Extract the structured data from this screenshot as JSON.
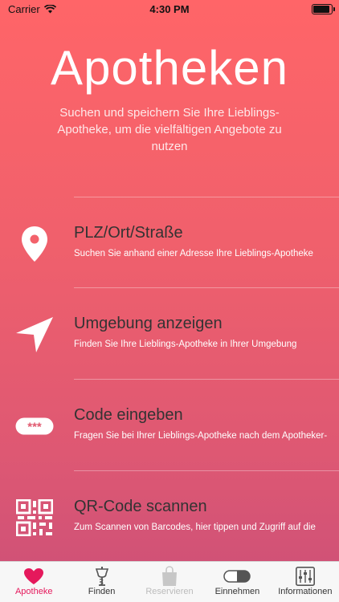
{
  "status": {
    "carrier": "Carrier",
    "time": "4:30 PM"
  },
  "header": {
    "title": "Apotheken",
    "subtitle": "Suchen und speichern Sie Ihre Lieblings-Apotheke, um die vielfältigen Angebote zu nutzen"
  },
  "options": [
    {
      "label": "PLZ/Ort/Straße",
      "desc": "Suchen Sie anhand einer Adresse Ihre Lieblings-Apotheke",
      "icon": "location-pin-icon"
    },
    {
      "label": "Umgebung anzeigen",
      "desc": "Finden Sie Ihre Lieblings-Apotheke in Ihrer Umgebung",
      "icon": "navigation-arrow-icon"
    },
    {
      "label": "Code eingeben",
      "desc": "Fragen Sie bei Ihrer Lieblings-Apotheke nach dem Apotheker-",
      "icon": "code-input-icon",
      "icon_text": "***"
    },
    {
      "label": "QR-Code scannen",
      "desc": "Zum Scannen von Barcodes, hier tippen und Zugriff auf die",
      "icon": "qr-code-icon"
    }
  ],
  "tabs": [
    {
      "label": "Apotheke",
      "icon": "heart-icon",
      "state": "active"
    },
    {
      "label": "Finden",
      "icon": "pharmacy-icon",
      "state": "normal"
    },
    {
      "label": "Reservieren",
      "icon": "shopping-bag-icon",
      "state": "disabled"
    },
    {
      "label": "Einnehmen",
      "icon": "pill-icon",
      "state": "normal"
    },
    {
      "label": "Informationen",
      "icon": "sliders-icon",
      "state": "normal"
    }
  ],
  "colors": {
    "gradient_top": "#FF6568",
    "gradient_bottom": "#CC5078",
    "active_tab": "#E5195C",
    "label_text": "#333333"
  }
}
